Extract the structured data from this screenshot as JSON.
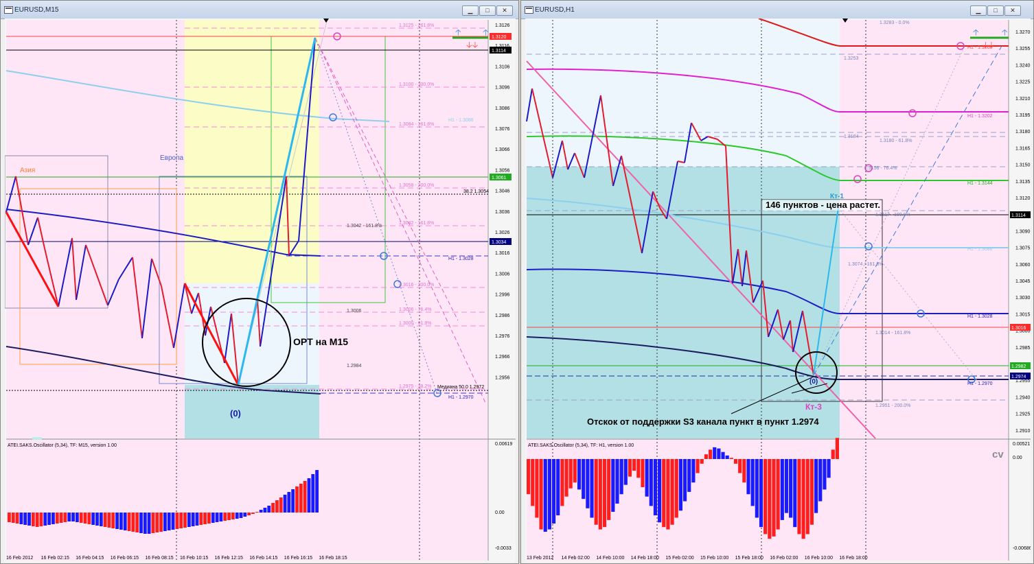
{
  "left": {
    "title": "EURUSD,M15",
    "sub_label": "ATEI.SAKS.Oscillator (5,34), TF: M15, version 1.00",
    "price_labels": [
      "1.3126",
      "1.3116",
      "1.3106",
      "1.3096",
      "1.3086",
      "1.3076",
      "1.3066",
      "1.3056",
      "1.3046",
      "1.3036",
      "1.3026",
      "1.3016",
      "1.3006",
      "1.2996",
      "1.2986",
      "1.2976",
      "1.2966",
      "1.2956"
    ],
    "price_badges": [
      {
        "text": "1.3120",
        "color": "#ff2a2a"
      },
      {
        "text": "1.3114",
        "color": "#000000"
      },
      {
        "text": "1.3061",
        "color": "#22aa22"
      },
      {
        "text": "1.3034",
        "color": "#000080"
      }
    ],
    "osc_labels": [
      "0.00619",
      "0.00",
      "-0.0033"
    ],
    "time_labels": [
      "16 Feb 2012",
      "16 Feb 02:15",
      "16 Feb 04:15",
      "16 Feb 06:15",
      "16 Feb 08:15",
      "16 Feb 10:15",
      "16 Feb 12:15",
      "16 Feb 14:15",
      "16 Feb 16:15",
      "16 Feb 18:15"
    ],
    "annotations": {
      "asia": "Азия",
      "europe": "Европа",
      "opt": "OPT на M15",
      "zero": "(0)"
    },
    "fib_labels": [
      "1.3125 - 261.8%",
      "1.3100 - 300.0%",
      "1.3084 - 161.8%",
      "1.3058 - 200.0%",
      "1.3042 - 161.8%",
      "1.3016 - 200.0%",
      "1.3006 - 76.4%",
      "1.3000 - 61.8%",
      "1.2975 - 38.2%"
    ],
    "level_labels": [
      "H1 - 1.3086",
      "38.2 1.3054",
      "1.3042 - 161.8%",
      "H1 - 1.3028",
      "1.3006",
      "1.2984",
      "Медиана 50.0 1.2972",
      "H1 - 1.2970"
    ],
    "osc_values": [
      -0.0014,
      -0.0015,
      -0.0016,
      -0.0017,
      -0.0018,
      -0.0019,
      -0.002,
      -0.0021,
      -0.002,
      -0.0019,
      -0.0018,
      -0.0017,
      -0.0016,
      -0.0015,
      -0.0014,
      -0.0013,
      -0.0013,
      -0.0014,
      -0.0015,
      -0.0016,
      -0.0017,
      -0.0018,
      -0.0019,
      -0.002,
      -0.0021,
      -0.0022,
      -0.0023,
      -0.0024,
      -0.0025,
      -0.0026,
      -0.0027,
      -0.0028,
      -0.0029,
      -0.003,
      -0.0031,
      -0.0031,
      -0.003,
      -0.0029,
      -0.0028,
      -0.0027,
      -0.0026,
      -0.0025,
      -0.0024,
      -0.0023,
      -0.0022,
      -0.0021,
      -0.002,
      -0.0019,
      -0.0018,
      -0.0017,
      -0.0016,
      -0.0015,
      -0.0014,
      -0.0013,
      -0.0012,
      -0.0011,
      -0.001,
      -0.0009,
      -0.0008,
      -0.0006,
      -0.0004,
      -0.0002,
      0.0001,
      0.0004,
      0.0007,
      0.001,
      0.0014,
      0.0018,
      0.0022,
      0.0026,
      0.003,
      0.0034,
      0.0038,
      0.0042,
      0.0046,
      0.005,
      0.0056,
      0.0062
    ]
  },
  "right": {
    "title": "EURUSD,H1",
    "sub_label": "ATEI.SAKS.Oscillator (5,34), TF: H1, version 1.00",
    "watermark": "cv",
    "price_labels": [
      "1.3270",
      "1.3255",
      "1.3240",
      "1.3225",
      "1.3210",
      "1.3195",
      "1.3180",
      "1.3165",
      "1.3150",
      "1.3135",
      "1.3120",
      "1.3105",
      "1.3090",
      "1.3075",
      "1.3060",
      "1.3045",
      "1.3030",
      "1.3015",
      "1.3000",
      "1.2985",
      "1.2970",
      "1.2955",
      "1.2940",
      "1.2925",
      "1.2910"
    ],
    "price_badges": [
      {
        "text": "1.3114",
        "color": "#000000"
      },
      {
        "text": "1.3016",
        "color": "#ff2a2a"
      },
      {
        "text": "1.2982",
        "color": "#22aa22"
      },
      {
        "text": "1.2974",
        "color": "#000080"
      }
    ],
    "osc_labels": [
      "0.00521",
      "0.00",
      "-0.00686"
    ],
    "time_labels": [
      "13 Feb 2012",
      "14 Feb 02:00",
      "14 Feb 10:00",
      "14 Feb 18:00",
      "15 Feb 02:00",
      "15 Feb 10:00",
      "15 Feb 18:00",
      "16 Feb 02:00",
      "16 Feb 10:00",
      "16 Feb 18:00"
    ],
    "annotations": {
      "info": "146 пунктов - цена растет.",
      "bounce": "Отскок от поддержки S3 канала пункт в пункт 1.2974",
      "kt1": "Кт-1",
      "kt3": "Кт-3",
      "zero": "(0)"
    },
    "fib_labels": [
      "1.3283 - 0.0%",
      "1.3253",
      "1.3184",
      "1.3180 - 61.8%",
      "1.3156 - 76.4%",
      "1.3117 - 100.0%",
      "1.3074 - 161.8%",
      "1.3014 - 161.8%",
      "1.2951 - 200.0%"
    ],
    "level_labels": [
      "H1 - 1.3260",
      "H1 - 1.3202",
      "H1 - 1.3144",
      "H1 - 1.3086",
      "H1 - 1.3028",
      "H1 - 1.2970"
    ],
    "osc_values": [
      -0.003,
      -0.004,
      -0.005,
      -0.006,
      -0.0062,
      -0.006,
      -0.0055,
      -0.0048,
      -0.004,
      -0.0032,
      -0.0025,
      -0.002,
      -0.0026,
      -0.0034,
      -0.0042,
      -0.005,
      -0.0056,
      -0.006,
      -0.0058,
      -0.0052,
      -0.0045,
      -0.0038,
      -0.003,
      -0.0022,
      -0.0015,
      -0.001,
      -0.0016,
      -0.0024,
      -0.0032,
      -0.004,
      -0.0048,
      -0.0054,
      -0.0058,
      -0.006,
      -0.0056,
      -0.005,
      -0.0044,
      -0.0036,
      -0.0028,
      -0.002,
      -0.0012,
      -0.0004,
      0.0004,
      0.0008,
      0.001,
      0.0009,
      0.0006,
      0.0003,
      0.0001,
      -0.0004,
      -0.0012,
      -0.002,
      -0.003,
      -0.004,
      -0.005,
      -0.0058,
      -0.0064,
      -0.0068,
      -0.0066,
      -0.006,
      -0.0052,
      -0.0046,
      -0.005,
      -0.0058,
      -0.0064,
      -0.0068,
      -0.0064,
      -0.0056,
      -0.0046,
      -0.0036,
      -0.0026,
      -0.0016,
      0.0008,
      0.0018
    ]
  }
}
